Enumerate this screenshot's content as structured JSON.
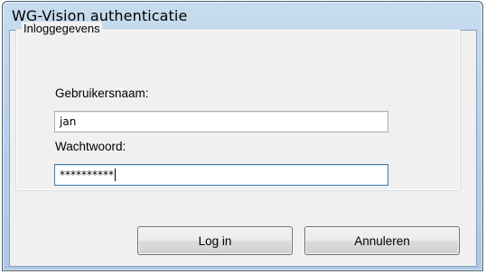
{
  "window": {
    "title": "WG-Vision authenticatie"
  },
  "group": {
    "legend": "Inloggegevens"
  },
  "fields": {
    "username_label": "Gebruikersnaam:",
    "username_value": "jan",
    "password_label": "Wachtwoord:",
    "password_value": "**********"
  },
  "buttons": {
    "login_label": "Log in",
    "cancel_label": "Annuleren"
  },
  "colors": {
    "titlebar": "#b9d1ea",
    "client_bg": "#f0f0f0",
    "focus_border": "#3d7bad"
  }
}
